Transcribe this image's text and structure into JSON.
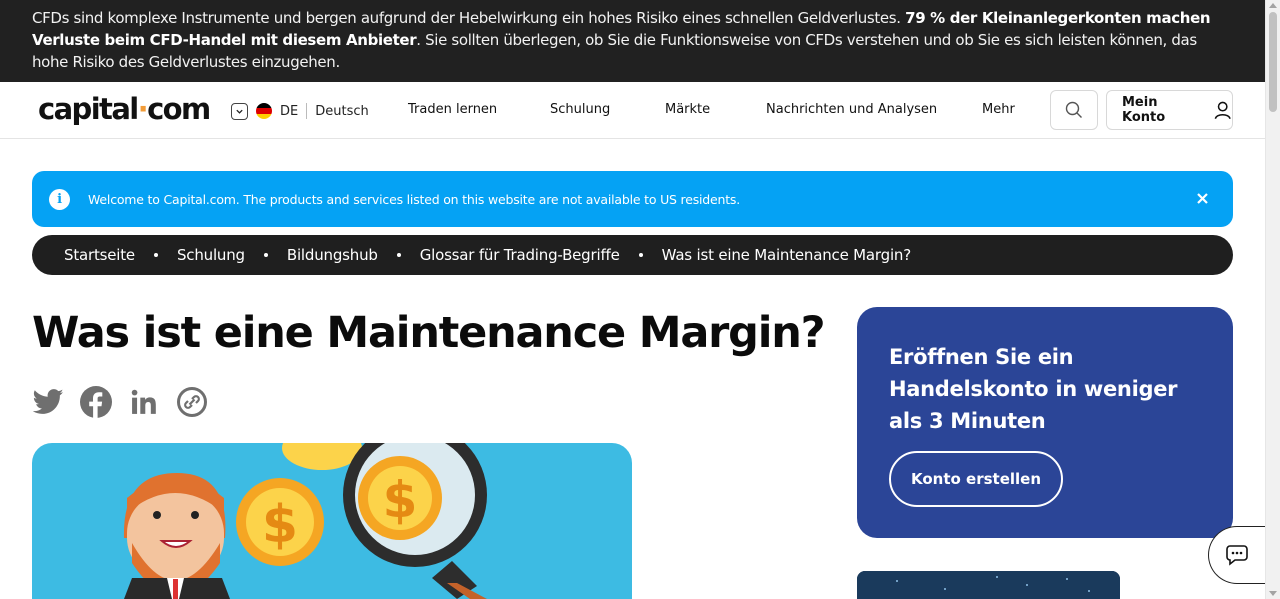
{
  "risk_banner": {
    "text_before": "CFDs sind komplexe Instrumente und bergen aufgrund der Hebelwirkung ein hohes Risiko eines schnellen Geldverlustes. ",
    "text_bold": "79 % der Kleinanlegerkonten machen Verluste beim CFD-Handel mit diesem Anbieter",
    "text_after": ". Sie sollten überlegen, ob Sie die Funktionsweise von CFDs verstehen und ob Sie es sich leisten können, das hohe Risiko des Geldverlustes einzugehen."
  },
  "header": {
    "logo_part1": "capital",
    "logo_dot": "·",
    "logo_part2": "com",
    "lang_code": "DE",
    "lang_name": "Deutsch",
    "nav": [
      "Traden lernen",
      "Schulung",
      "Märkte",
      "Nachrichten und Analysen",
      "Mehr"
    ],
    "account_label": "Mein Konto"
  },
  "notice": {
    "text": "Welcome to Capital.com. The products and services listed on this website are not available to US residents."
  },
  "breadcrumb": [
    "Startseite",
    "Schulung",
    "Bildungshub",
    "Glossar für Trading-Begriffe",
    "Was ist eine Maintenance Margin?"
  ],
  "article": {
    "title": "Was ist eine Maintenance Margin?"
  },
  "social": [
    "twitter-icon",
    "facebook-icon",
    "linkedin-icon",
    "copy-link-icon"
  ],
  "signup_card": {
    "heading": "Eröffnen Sie ein Handelskonto in weniger als 3 Minuten",
    "cta": "Konto erstellen"
  },
  "colors": {
    "risk_bg": "#212121",
    "notice_bg": "#05a2f4",
    "breadcrumb_bg": "#1f1f1f",
    "card_bg": "#2b4597",
    "logo_dot": "#f29c38",
    "hero_bg": "#3dbbe3"
  }
}
